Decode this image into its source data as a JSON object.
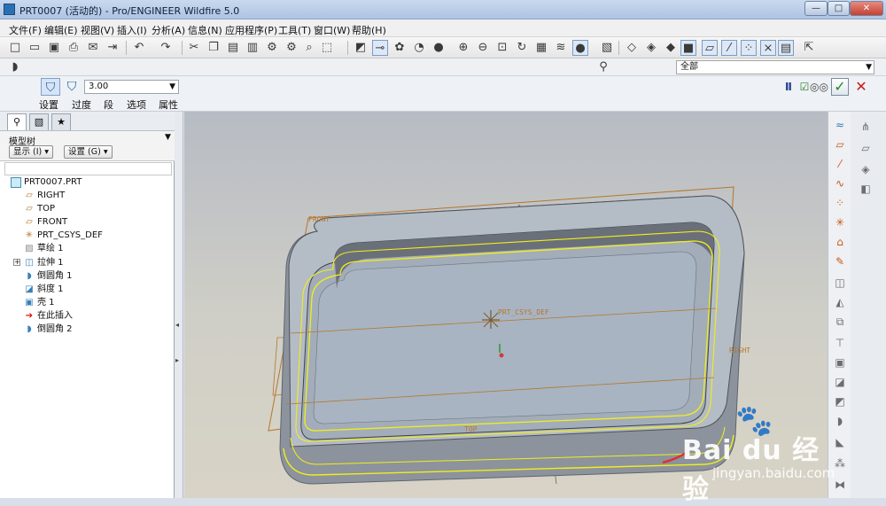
{
  "window": {
    "title": "PRT0007 (活动的) - Pro/ENGINEER Wildfire 5.0",
    "controls": [
      "—",
      "□",
      "✕"
    ]
  },
  "menu": [
    "文件(F)",
    "编辑(E)",
    "视图(V)",
    "插入(I)",
    "分析(A)",
    "信息(N)",
    "应用程序(P)",
    "工具(T)",
    "窗口(W)",
    "帮助(H)"
  ],
  "filter": {
    "value": "全部"
  },
  "dashboard": {
    "radius_value": "3.00",
    "tabs": [
      "设置",
      "过度",
      "段",
      "选项",
      "属性"
    ]
  },
  "navigator": {
    "title": "模型树",
    "show_button": "显示 (I)",
    "settings_button": "设置 (G)",
    "tree": [
      {
        "label": "PRT0007.PRT",
        "icon": "part-icon"
      },
      {
        "label": "RIGHT",
        "icon": "datum-plane-icon"
      },
      {
        "label": "TOP",
        "icon": "datum-plane-icon"
      },
      {
        "label": "FRONT",
        "icon": "datum-plane-icon"
      },
      {
        "label": "PRT_CSYS_DEF",
        "icon": "coordinate-system-icon"
      },
      {
        "label": "草绘 1",
        "icon": "sketch-icon"
      },
      {
        "label": "拉伸 1",
        "icon": "extrude-icon"
      },
      {
        "label": "倒圆角 1",
        "icon": "round-icon"
      },
      {
        "label": "斜度 1",
        "icon": "draft-icon"
      },
      {
        "label": "壳 1",
        "icon": "shell-icon"
      },
      {
        "label": "在此插入",
        "icon": "insert-here-icon"
      },
      {
        "label": "倒圆角 2",
        "icon": "round-icon"
      }
    ]
  },
  "model_labels": {
    "front": "FRONT",
    "top": "TOP",
    "right": "RIGHT",
    "csys": "PRT_CSYS_DEF"
  },
  "colors": {
    "selection_yellow": "#f2ee1a",
    "datum_brown": "#b5762c",
    "model_body": "#a9b1bb",
    "model_shadow": "#5f6570",
    "accent_red": "#e0302a"
  },
  "watermark": {
    "brand": "Bai du 经验",
    "url": "jingyan.baidu.com"
  }
}
